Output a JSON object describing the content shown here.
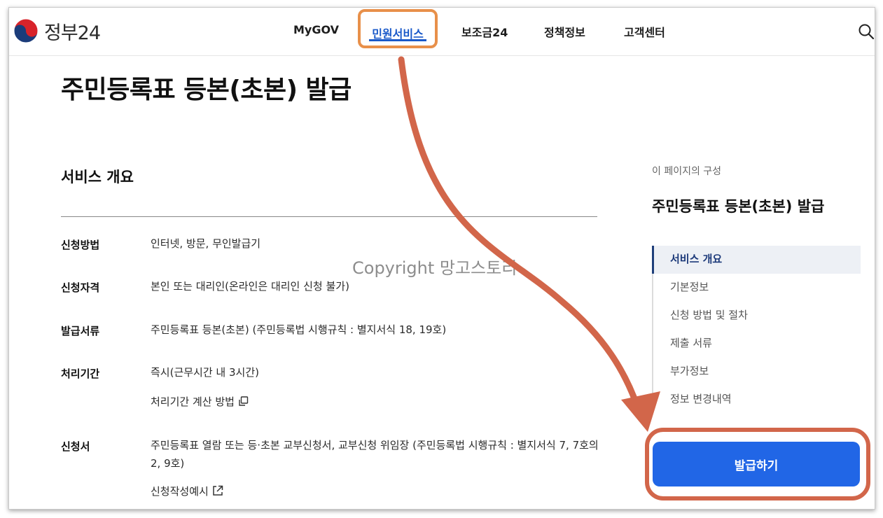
{
  "header": {
    "logo_text": "정부24",
    "nav": [
      "MyGOV",
      "민원서비스",
      "보조금24",
      "정책정보",
      "고객센터"
    ],
    "active_nav": "민원서비스"
  },
  "page": {
    "title": "주민등록표 등본(초본) 발급"
  },
  "overview": {
    "title": "서비스 개요",
    "rows": [
      {
        "label": "신청방법",
        "value": "인터넷, 방문, 무인발급기"
      },
      {
        "label": "신청자격",
        "value": "본인 또는 대리인(온라인은 대리인 신청 불가)"
      },
      {
        "label": "발급서류",
        "value": "주민등록표 등본(초본) (주민등록법 시행규칙 : 별지서식 18, 19호)"
      },
      {
        "label": "처리기간",
        "value": "즉시(근무시간 내 3시간)",
        "link": "처리기간 계산 방법"
      },
      {
        "label": "신청서",
        "value": "주민등록표 열람 또는 등·초본 교부신청서, 교부신청 위임장 (주민등록법 시행규칙 : 별지서식 7, 7호의2, 9호)",
        "link": "신청작성예시"
      }
    ]
  },
  "watermark": "Copyright 망고스토리",
  "toc": {
    "caption": "이 페이지의 구성",
    "title": "주민등록표 등본(초본) 발급",
    "items": [
      "서비스 개요",
      "기본정보",
      "신청 방법 및 절차",
      "제출 서류",
      "부가정보",
      "정보 변경내역"
    ],
    "active_index": 0
  },
  "cta": {
    "label": "발급하기",
    "color": "#2166e6"
  },
  "annotation": {
    "highlight_color": "#e8904a",
    "arrow_color": "#d2664a"
  }
}
